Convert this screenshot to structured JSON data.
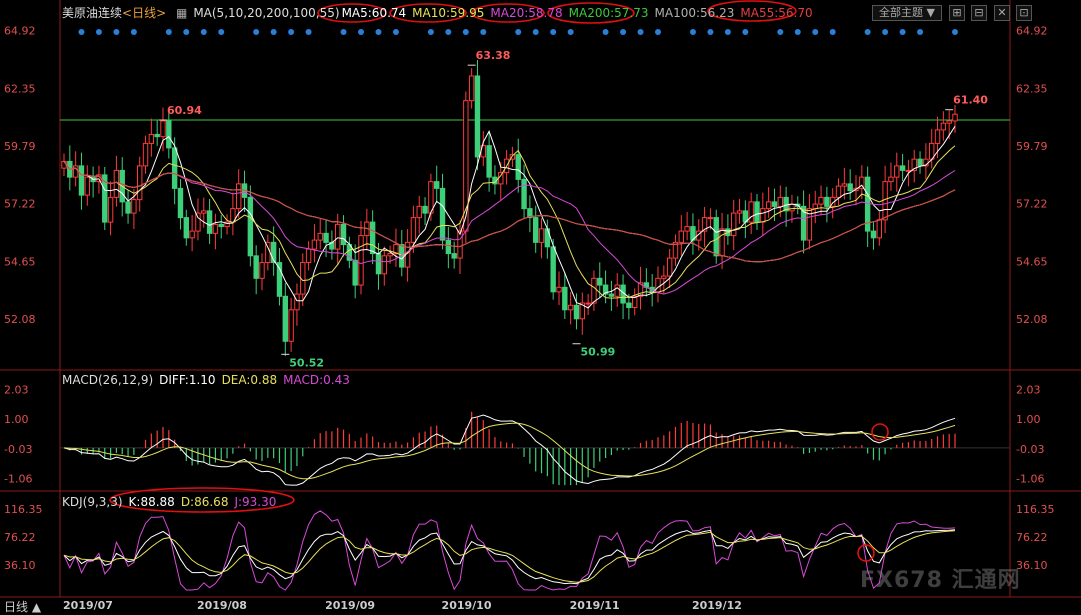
{
  "header": {
    "symbol": "美原油连续",
    "period": "<日线>",
    "ma_prefix": "MA(5,10,20,200,100,55)",
    "ma_items": [
      {
        "label": "MA5:60.74",
        "color": "#ffffff"
      },
      {
        "label": "MA10:59.95",
        "color": "#e8e05a"
      },
      {
        "label": "MA20:58.78",
        "color": "#d84ad8"
      },
      {
        "label": "MA200:57.73",
        "color": "#3cc83c"
      },
      {
        "label": "MA100:56.23",
        "color": "#b0b0b0"
      },
      {
        "label": "MA55:56.70",
        "color": "#e04040"
      }
    ],
    "theme_dropdown": "全部主题",
    "buttons": [
      "⊞",
      "⊟",
      "✕",
      "⊡"
    ]
  },
  "macd_header": {
    "name": "MACD(26,12,9)",
    "diff": "DIFF:1.10",
    "dea": "DEA:0.88",
    "macd": "MACD:0.43"
  },
  "kdj_header": {
    "name": "KDJ(9,3,3)",
    "k": "K:88.88",
    "d": "D:86.68",
    "j": "J:93.30"
  },
  "bottom": {
    "period_tab": "日线 ▲"
  },
  "watermark": "FX678 汇通网",
  "colors": {
    "up": "#ff3b3b",
    "down": "#3ecf7a",
    "bg": "#000000",
    "axis": "#e05050",
    "annotation_circle": "#e01010"
  },
  "chart_data": {
    "type": "candlestick",
    "x_ticks": [
      "2019/07",
      "2019/08",
      "2019/09",
      "2019/10",
      "2019/11",
      "2019/12"
    ],
    "price_axis": {
      "ticks": [
        64.92,
        62.35,
        59.79,
        57.22,
        54.65,
        52.08
      ],
      "ylim": [
        50.0,
        65.3
      ]
    },
    "reference_line": 60.94,
    "annotations": [
      {
        "label": "60.94",
        "value": 60.94
      },
      {
        "label": "63.38",
        "value": 63.38
      },
      {
        "label": "50.52",
        "value": 50.52
      },
      {
        "label": "50.99",
        "value": 50.99
      },
      {
        "label": "61.40",
        "value": 61.4
      }
    ],
    "close": [
      59.1,
      58.4,
      58.9,
      57.6,
      58.4,
      58.2,
      58.5,
      56.4,
      57.5,
      58.7,
      57.3,
      56.8,
      57.4,
      58.9,
      59.9,
      60.3,
      60.2,
      60.9,
      59.7,
      57.9,
      56.6,
      55.7,
      56.0,
      56.8,
      56.9,
      55.9,
      56.3,
      56.2,
      56.4,
      57.0,
      58.1,
      57.5,
      54.9,
      53.9,
      54.6,
      55.5,
      54.6,
      53.1,
      51.1,
      52.5,
      53.2,
      54.6,
      55.2,
      55.6,
      55.9,
      55.5,
      55.2,
      56.3,
      55.4,
      54.7,
      53.6,
      55.8,
      56.4,
      55.0,
      54.1,
      54.9,
      55.0,
      55.4,
      54.4,
      55.5,
      56.6,
      57.1,
      56.8,
      58.2,
      57.9,
      55.6,
      55.0,
      54.8,
      56.0,
      61.8,
      62.9,
      59.3,
      59.8,
      58.4,
      58.1,
      58.6,
      59.2,
      59.4,
      58.3,
      57.0,
      56.6,
      55.5,
      56.1,
      55.3,
      53.3,
      53.5,
      52.5,
      52.7,
      52.1,
      52.8,
      52.8,
      53.9,
      53.6,
      53.2,
      53.1,
      53.6,
      52.8,
      52.6,
      53.1,
      53.7,
      53.5,
      53.3,
      53.9,
      54.0,
      54.8,
      55.5,
      56.0,
      56.2,
      55.6,
      56.0,
      56.6,
      56.6,
      54.9,
      56.1,
      55.8,
      56.8,
      56.9,
      56.4,
      57.3,
      56.4,
      57.0,
      57.3,
      57.1,
      57.5,
      56.9,
      57.2,
      57.1,
      55.6,
      57.0,
      57.2,
      57.5,
      57.1,
      57.5,
      58.0,
      58.1,
      57.8,
      57.9,
      58.4,
      56.0,
      55.7,
      56.5,
      58.2,
      58.4,
      58.9,
      58.7,
      58.7,
      59.2,
      58.9,
      59.2,
      59.9,
      60.5,
      60.8,
      60.9,
      61.2
    ],
    "ma_series": [
      {
        "name": "MA5",
        "color": "#ffffff",
        "period": 5
      },
      {
        "name": "MA10",
        "color": "#e8e05a",
        "period": 10
      },
      {
        "name": "MA20",
        "color": "#d84ad8",
        "period": 20
      },
      {
        "name": "MA200",
        "color": "#3cc83c",
        "period": 200
      },
      {
        "name": "MA100",
        "color": "#b0b0b0",
        "period": 100
      },
      {
        "name": "MA55",
        "color": "#e04040",
        "period": 55
      }
    ],
    "macd_axis": {
      "ticks": [
        2.03,
        1.0,
        -0.03,
        -1.06
      ],
      "ylim": [
        -1.4,
        2.3
      ]
    },
    "kdj_axis": {
      "ticks": [
        116.35,
        76.22,
        36.1
      ],
      "ylim": [
        0,
        125
      ]
    }
  }
}
